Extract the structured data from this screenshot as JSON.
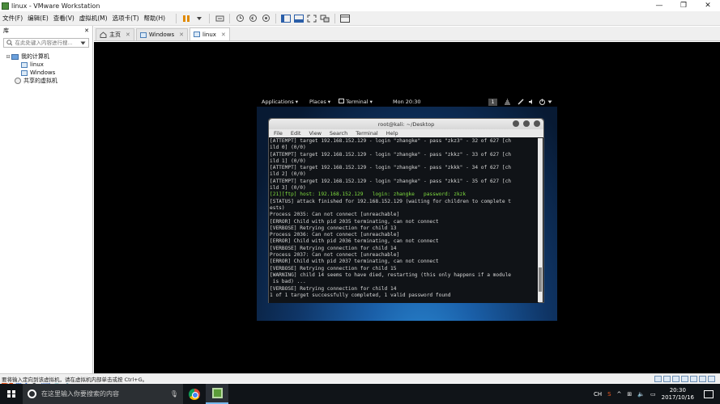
{
  "window": {
    "title": "linux - VMware Workstation",
    "controls": [
      "—",
      "❐",
      "✕"
    ]
  },
  "menu": [
    "文件(F)",
    "编辑(E)",
    "查看(V)",
    "虚拟机(M)",
    "选项卡(T)",
    "帮助(H)"
  ],
  "sidebar": {
    "header": "库",
    "close": "✕",
    "search_placeholder": "在此处键入内容进行搜...",
    "tree": {
      "root": "我的计算机",
      "items": [
        "linux",
        "Windows"
      ],
      "shared": "共享的虚拟机"
    },
    "ime": [
      "S",
      "中",
      "•",
      "🎤",
      "⌨",
      "👕",
      "🔧"
    ]
  },
  "tabs": [
    {
      "label": "主页",
      "close": "✕"
    },
    {
      "label": "Windows",
      "close": "✕"
    },
    {
      "label": "linux",
      "close": "✕"
    }
  ],
  "kali": {
    "topbar": {
      "applications": "Applications ▾",
      "places": "Places ▾",
      "terminal": "Terminal ▾",
      "clock": "Mon 20:30",
      "workspace": "1"
    },
    "terminal": {
      "title": "root@kali: ~/Desktop",
      "menu": [
        "File",
        "Edit",
        "View",
        "Search",
        "Terminal",
        "Help"
      ],
      "lines": [
        {
          "text": "[ATTEMPT] target 192.168.152.129 - login \"zhangke\" - pass \"zkz3\" - 32 of 627 [ch",
          "green": false
        },
        {
          "text": "ild 0] (0/0)",
          "green": false
        },
        {
          "text": "[ATTEMPT] target 192.168.152.129 - login \"zhangke\" - pass \"zkkz\" - 33 of 627 [ch",
          "green": false
        },
        {
          "text": "ild 1] (0/0)",
          "green": false
        },
        {
          "text": "[ATTEMPT] target 192.168.152.129 - login \"zhangke\" - pass \"zkkk\" - 34 of 627 [ch",
          "green": false
        },
        {
          "text": "ild 2] (0/0)",
          "green": false
        },
        {
          "text": "[ATTEMPT] target 192.168.152.129 - login \"zhangke\" - pass \"zkk1\" - 35 of 627 [ch",
          "green": false
        },
        {
          "text": "ild 3] (0/0)",
          "green": false
        },
        {
          "text": "[21][ftp] host: 192.168.152.129   login: zhangke   password: zkzk",
          "green": true
        },
        {
          "text": "[STATUS] attack finished for 192.168.152.129 (waiting for children to complete t",
          "green": false
        },
        {
          "text": "ests)",
          "green": false
        },
        {
          "text": "Process 2035: Can not connect [unreachable]",
          "green": false
        },
        {
          "text": "[ERROR] Child with pid 2035 terminating, can not connect",
          "green": false
        },
        {
          "text": "[VERBOSE] Retrying connection for child 13",
          "green": false
        },
        {
          "text": "Process 2036: Can not connect [unreachable]",
          "green": false
        },
        {
          "text": "[ERROR] Child with pid 2036 terminating, can not connect",
          "green": false
        },
        {
          "text": "[VERBOSE] Retrying connection for child 14",
          "green": false
        },
        {
          "text": "Process 2037: Can not connect [unreachable]",
          "green": false
        },
        {
          "text": "[ERROR] Child with pid 2037 terminating, can not connect",
          "green": false
        },
        {
          "text": "[VERBOSE] Retrying connection for child 15",
          "green": false
        },
        {
          "text": "[WARNING] child 14 seems to have died, restarting (this only happens if a module",
          "green": false
        },
        {
          "text": " is bad) ...",
          "green": false
        },
        {
          "text": "[VERBOSE] Retrying connection for child 14",
          "green": false
        },
        {
          "text": "1 of 1 target successfully completed, 1 valid password found",
          "green": false
        }
      ]
    }
  },
  "statusbar": {
    "text": "要将输入定向到该虚拟机，请在虚拟机内部单击或按 Ctrl+G。"
  },
  "taskbar": {
    "search_placeholder": "在这里输入你要搜索的内容",
    "tray": [
      "CH",
      "S",
      "^",
      "⊞",
      "🔈",
      "▭"
    ],
    "time": "20:30",
    "date": "2017/10/16"
  },
  "colors": {
    "terminal_bg": "#101317",
    "highlight_green": "#7fdc3f",
    "taskbar_bg": "#101418"
  }
}
